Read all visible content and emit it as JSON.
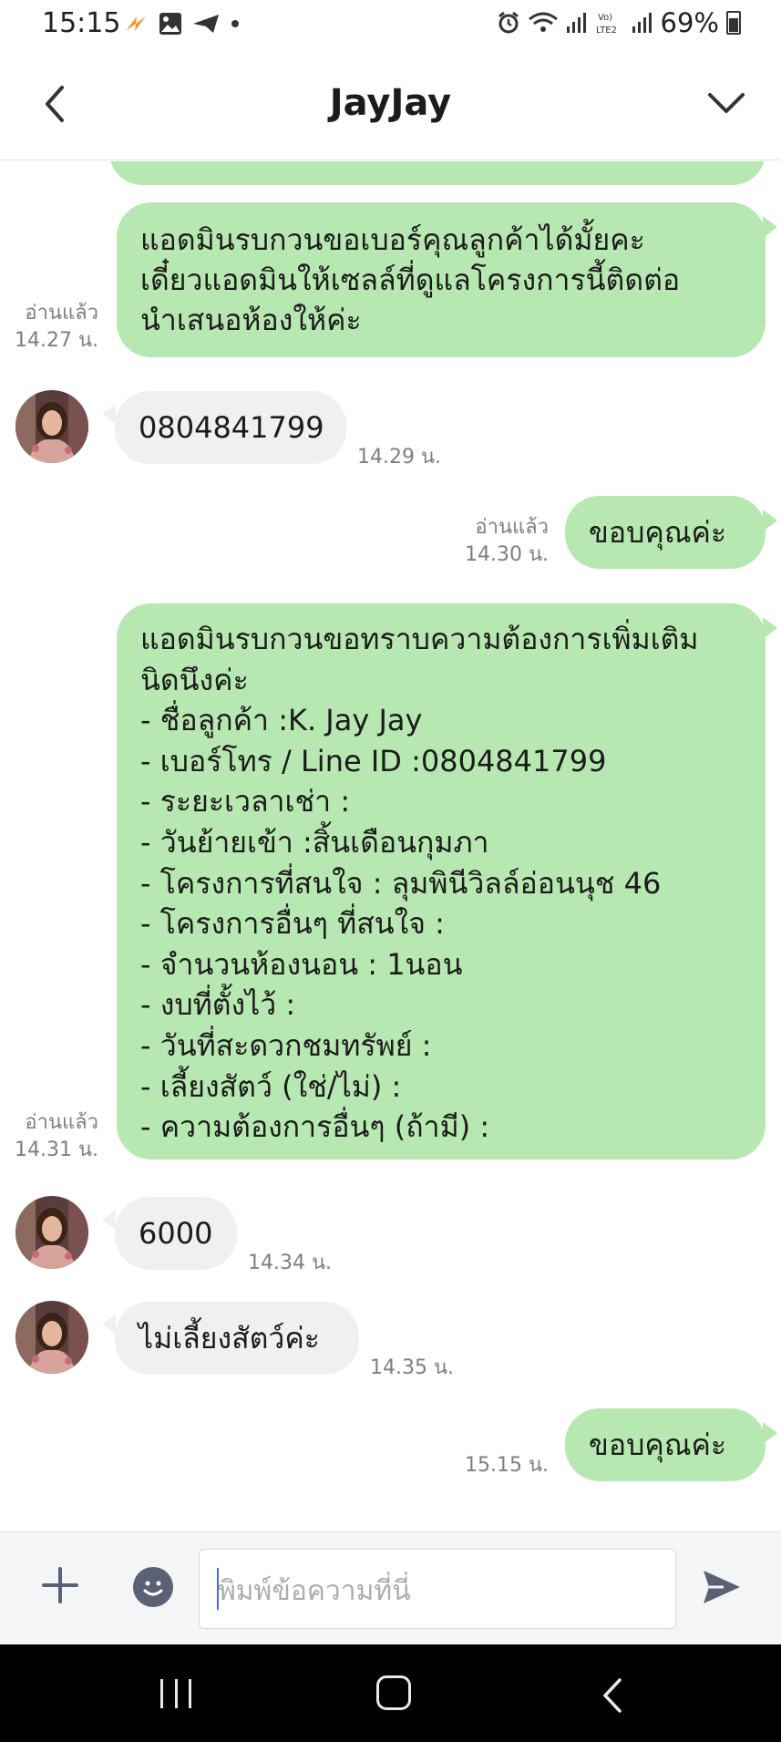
{
  "status_bar": {
    "time": "15:15",
    "battery": "69%",
    "icons": [
      "flash-icon",
      "image-icon",
      "send-icon",
      "dot-icon",
      "alarm-icon",
      "wifi-icon",
      "signal-icon",
      "volte-icon",
      "signal-icon",
      "battery-icon"
    ]
  },
  "header": {
    "title": "JayJay",
    "back_icon": "back-arrow-icon",
    "menu_icon": "chevron-down-icon"
  },
  "messages": {
    "m1": {
      "lines": [
        "แอดมินรบกวนขอเบอร์คุณลูกค้าได้มั้ยคะ",
        "เดี๋ยวแอดมินให้เซลล์ที่ดูแลโครงการนี้ติดต่อ",
        "นำเสนอห้องให้ค่ะ"
      ],
      "read": "อ่านแล้ว",
      "time": "14.27 น."
    },
    "m2": {
      "text": "0804841799",
      "time": "14.29 น."
    },
    "m3": {
      "text": "ขอบคุณค่ะ",
      "read": "อ่านแล้ว",
      "time": "14.30 น."
    },
    "m4": {
      "lines": [
        "แอดมินรบกวนขอทราบความต้องการเพิ่มเติม",
        "นิดนึงค่ะ",
        "- ชื่อลูกค้า :K. Jay Jay",
        "- เบอร์โทร / Line ID :0804841799",
        "- ระยะเวลาเช่า :",
        "- วันย้ายเข้า :สิ้นเดือนกุมภา",
        "- โครงการที่สนใจ : ลุมพินีวิลล์อ่อนนุช 46",
        "- โครงการอื่นๆ ที่สนใจ :",
        "- จำนวนห้องนอน : 1นอน",
        "- งบที่ตั้งไว้ :",
        "- วันที่สะดวกชมทรัพย์ :",
        "- เลี้ยงสัตว์ (ใช่/ไม่) :",
        "- ความต้องการอื่นๆ (ถ้ามี) :"
      ],
      "read": "อ่านแล้ว",
      "time": "14.31 น."
    },
    "m5": {
      "text": "6000",
      "time": "14.34 น."
    },
    "m6": {
      "text": "ไม่เลี้ยงสัตว์ค่ะ",
      "time": "14.35 น."
    },
    "m7": {
      "text": "ขอบคุณค่ะ",
      "time": "15.15 น."
    }
  },
  "input": {
    "placeholder": "พิมพ์ข้อความที่นี่"
  },
  "colors": {
    "outgoing_bubble": "#b8e8b1",
    "incoming_bubble": "#f0f0f2",
    "meta_text": "#7b7f86",
    "send_icon": "#5b6174"
  }
}
